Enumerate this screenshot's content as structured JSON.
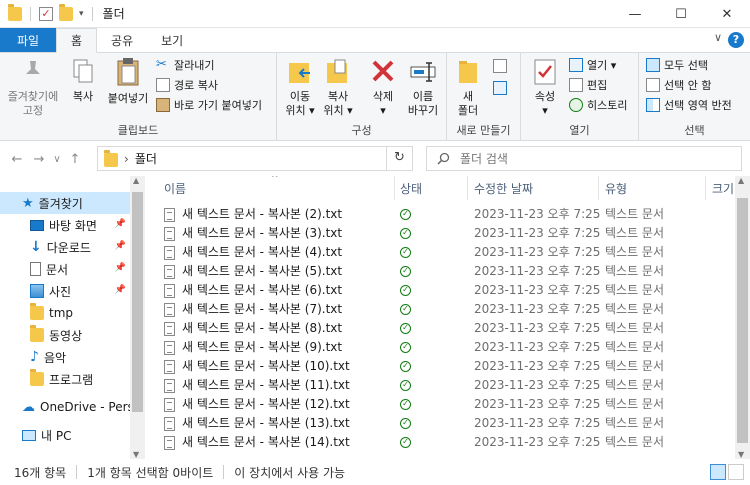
{
  "window": {
    "title": "폴더",
    "minimize": "—",
    "maximize": "☐",
    "close": "✕"
  },
  "tabs": [
    "파일",
    "홈",
    "공유",
    "보기"
  ],
  "ribbon": {
    "clipboard": {
      "label": "클립보드",
      "pin": "즐겨찾기에\n고정",
      "copy": "복사",
      "paste": "붙여넣기",
      "cut": "잘라내기",
      "copy_path": "경로 복사",
      "paste_shortcut": "바로 가기 붙여넣기"
    },
    "organize": {
      "label": "구성",
      "move": "이동\n위치 ▾",
      "copy_to": "복사\n위치 ▾",
      "delete": "삭제\n▾",
      "rename": "이름\n바꾸기"
    },
    "new": {
      "label": "새로 만들기",
      "new_folder": "새\n폴더"
    },
    "open": {
      "label": "열기",
      "properties": "속성\n▾",
      "open": "열기 ▾",
      "edit": "편집",
      "history": "히스토리"
    },
    "select": {
      "label": "선택",
      "select_all": "모두 선택",
      "select_none": "선택 안 함",
      "invert": "선택 영역 반전"
    }
  },
  "address": {
    "back": "←",
    "forward": "→",
    "recent": "∨",
    "up": "↑",
    "path_sep": "›",
    "path": "폴더",
    "refresh": "↻",
    "search_placeholder": "폴더 검색"
  },
  "sidebar": {
    "items": [
      {
        "label": "즐겨찾기",
        "icon": "star-icon",
        "pinned": false
      },
      {
        "label": "바탕 화면",
        "icon": "desktop-icon",
        "pinned": true
      },
      {
        "label": "다운로드",
        "icon": "download-icon",
        "pinned": true
      },
      {
        "label": "문서",
        "icon": "documents-icon",
        "pinned": true
      },
      {
        "label": "사진",
        "icon": "pictures-icon",
        "pinned": true
      },
      {
        "label": "tmp",
        "icon": "folder-icon",
        "pinned": false
      },
      {
        "label": "동영상",
        "icon": "folder-icon",
        "pinned": false
      },
      {
        "label": "음악",
        "icon": "music-icon",
        "pinned": false
      },
      {
        "label": "프로그램",
        "icon": "folder-icon",
        "pinned": false
      },
      {
        "label": "OneDrive - Perso",
        "icon": "onedrive-icon",
        "pinned": false
      },
      {
        "label": "내 PC",
        "icon": "pc-icon",
        "pinned": false
      }
    ],
    "pin_glyph": "📌"
  },
  "columns": {
    "name": "이름",
    "status": "상태",
    "modified": "수정한 날짜",
    "type": "유형",
    "size": "크기"
  },
  "files": [
    {
      "name": "새 텍스트 문서 - 복사본 (2).txt",
      "modified": "2023-11-23 오후 7:25",
      "type": "텍스트 문서"
    },
    {
      "name": "새 텍스트 문서 - 복사본 (3).txt",
      "modified": "2023-11-23 오후 7:25",
      "type": "텍스트 문서"
    },
    {
      "name": "새 텍스트 문서 - 복사본 (4).txt",
      "modified": "2023-11-23 오후 7:25",
      "type": "텍스트 문서"
    },
    {
      "name": "새 텍스트 문서 - 복사본 (5).txt",
      "modified": "2023-11-23 오후 7:25",
      "type": "텍스트 문서"
    },
    {
      "name": "새 텍스트 문서 - 복사본 (6).txt",
      "modified": "2023-11-23 오후 7:25",
      "type": "텍스트 문서"
    },
    {
      "name": "새 텍스트 문서 - 복사본 (7).txt",
      "modified": "2023-11-23 오후 7:25",
      "type": "텍스트 문서"
    },
    {
      "name": "새 텍스트 문서 - 복사본 (8).txt",
      "modified": "2023-11-23 오후 7:25",
      "type": "텍스트 문서"
    },
    {
      "name": "새 텍스트 문서 - 복사본 (9).txt",
      "modified": "2023-11-23 오후 7:25",
      "type": "텍스트 문서"
    },
    {
      "name": "새 텍스트 문서 - 복사본 (10).txt",
      "modified": "2023-11-23 오후 7:25",
      "type": "텍스트 문서"
    },
    {
      "name": "새 텍스트 문서 - 복사본 (11).txt",
      "modified": "2023-11-23 오후 7:25",
      "type": "텍스트 문서"
    },
    {
      "name": "새 텍스트 문서 - 복사본 (12).txt",
      "modified": "2023-11-23 오후 7:25",
      "type": "텍스트 문서"
    },
    {
      "name": "새 텍스트 문서 - 복사본 (13).txt",
      "modified": "2023-11-23 오후 7:25",
      "type": "텍스트 문서"
    },
    {
      "name": "새 텍스트 문서 - 복사본 (14).txt",
      "modified": "2023-11-23 오후 7:25",
      "type": "텍스트 문서"
    }
  ],
  "status": {
    "count": "16개 항목",
    "selected": "1개 항목 선택함 0바이트",
    "availability": "이 장치에서 사용 가능"
  },
  "colors": {
    "accent": "#1979ca",
    "selected_bg": "#cce8ff",
    "status_ok": "#107c10",
    "folder": "#f5c84c"
  }
}
